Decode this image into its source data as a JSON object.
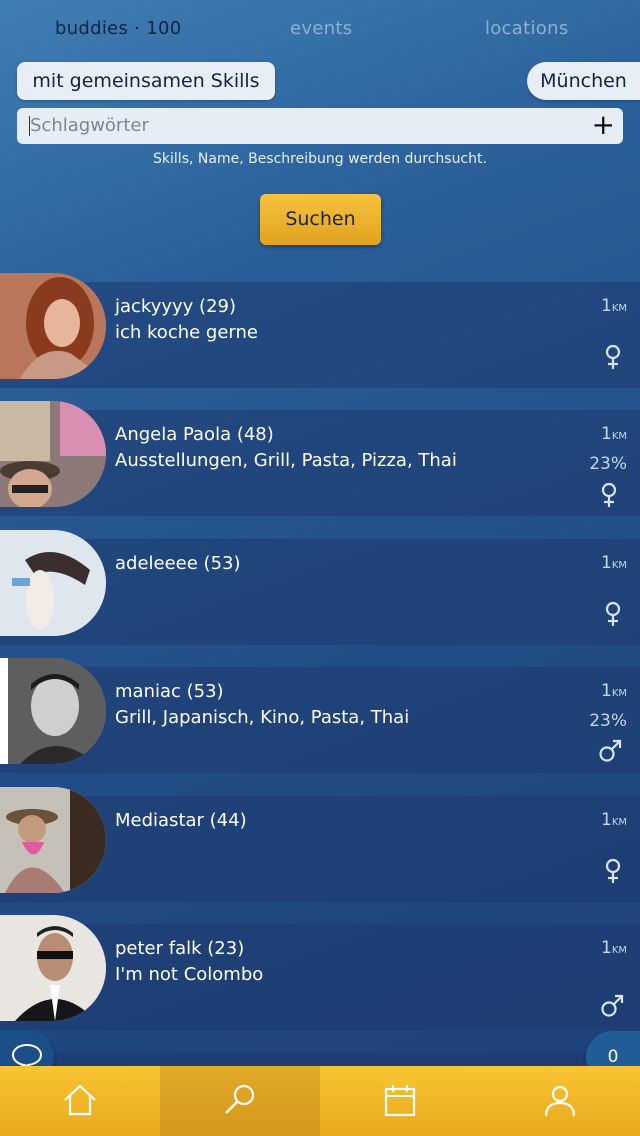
{
  "tabs": [
    {
      "label": "buddies · 100",
      "active": true
    },
    {
      "label": "events",
      "active": false
    },
    {
      "label": "locations",
      "active": false
    }
  ],
  "filters": {
    "skills_filter_label": "mit gemeinsamen Skills",
    "city_label": "München"
  },
  "search": {
    "placeholder": "Schlagwörter",
    "add_icon": "plus-icon",
    "hint": "Skills, Name, Beschreibung werden durchsucht.",
    "button_label": "Suchen"
  },
  "buddies": [
    {
      "name": "jackyyyy (29)",
      "description": "ich koche gerne",
      "distance": "1",
      "distance_unit": "KM",
      "match": "",
      "gender": "female"
    },
    {
      "name": "Angela Paola (48)",
      "description": "Ausstellungen, Grill, Pasta, Pizza, Thai",
      "distance": "1",
      "distance_unit": "KM",
      "match": "23%",
      "gender": "female"
    },
    {
      "name": "adeleeee (53)",
      "description": "",
      "distance": "1",
      "distance_unit": "KM",
      "match": "",
      "gender": "female"
    },
    {
      "name": "maniac (53)",
      "description": "Grill, Japanisch, Kino, Pasta, Thai",
      "distance": "1",
      "distance_unit": "KM",
      "match": "23%",
      "gender": "male"
    },
    {
      "name": "Mediastar (44)",
      "description": "",
      "distance": "1",
      "distance_unit": "KM",
      "match": "",
      "gender": "female"
    },
    {
      "name": "peter falk (23)",
      "description": "I'm not Colombo",
      "distance": "1",
      "distance_unit": "KM",
      "match": "",
      "gender": "male"
    }
  ],
  "floating": {
    "chat_icon": "chat-bubble-icon",
    "counter": "0"
  },
  "navbar": {
    "items": [
      {
        "icon": "home-icon",
        "active": false
      },
      {
        "icon": "search-icon",
        "active": true
      },
      {
        "icon": "calendar-icon",
        "active": false
      },
      {
        "icon": "profile-icon",
        "active": false
      }
    ]
  },
  "colors": {
    "accent": "#f3b62b",
    "background": "#2b5f99"
  }
}
